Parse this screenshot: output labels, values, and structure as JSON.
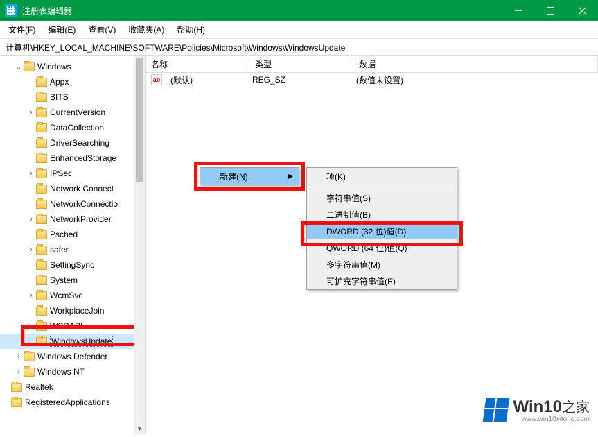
{
  "titlebar": {
    "title": "注册表编辑器"
  },
  "menubar": {
    "file": "文件(F)",
    "edit": "编辑(E)",
    "view": "查看(V)",
    "fav": "收藏夹(A)",
    "help": "帮助(H)"
  },
  "path": "计算机\\HKEY_LOCAL_MACHINE\\SOFTWARE\\Policies\\Microsoft\\Windows\\WindowsUpdate",
  "tree": {
    "root": "Windows",
    "items": [
      "Appx",
      "BITS",
      "CurrentVersion",
      "DataCollection",
      "DriverSearching",
      "EnhancedStorage",
      "IPSec",
      "Network Connect",
      "NetworkConnectio",
      "NetworkProvider",
      "Psched",
      "safer",
      "SettingSync",
      "System",
      "WcmSvc",
      "WorkplaceJoin",
      "WSDAPI",
      "WindowsUpdate"
    ],
    "after1": "Windows Defender",
    "after2": "Windows NT",
    "loose1": "Realtek",
    "loose2": "RegisteredApplications"
  },
  "listview": {
    "cols": {
      "name": "名称",
      "type": "类型",
      "data": "数据"
    },
    "row": {
      "name": "(默认)",
      "type": "REG_SZ",
      "data": "(数值未设置)"
    }
  },
  "context": {
    "new": "新建(N)",
    "sub": {
      "key": "项(K)",
      "string": "字符串值(S)",
      "binary": "二进制值(B)",
      "dword": "DWORD (32 位)值(D)",
      "qword": "QWORD (64 位)值(Q)",
      "multi": "多字符串值(M)",
      "expand": "可扩充字符串值(E)"
    }
  },
  "watermark": {
    "brand": "Win10",
    "suffix": "之家",
    "url": "www.win10xitong.com"
  }
}
